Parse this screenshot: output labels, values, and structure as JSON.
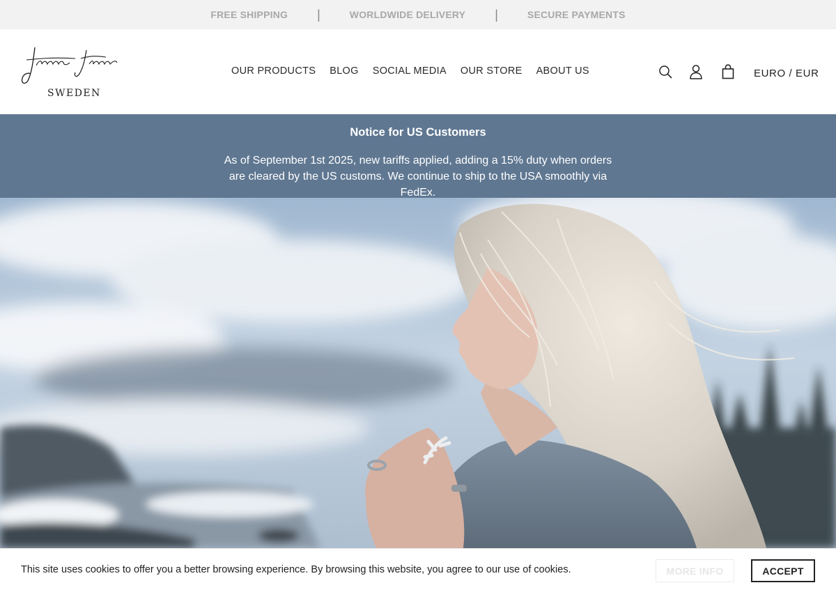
{
  "topbar": {
    "items": [
      "FREE SHIPPING",
      "WORLDWIDE DELIVERY",
      "SECURE PAYMENTS"
    ],
    "separator": "|"
  },
  "header": {
    "logo": {
      "signature": "Janna Sjöstam",
      "subtitle": "SWEDEN"
    },
    "nav": [
      "OUR PRODUCTS",
      "BLOG",
      "SOCIAL MEDIA",
      "OUR STORE",
      "ABOUT US"
    ],
    "icons": [
      "search-icon",
      "user-icon",
      "bag-icon"
    ],
    "currency": "EURO / EUR"
  },
  "notice": {
    "title": "Notice for US Customers",
    "body": "As of September 1st 2025, new tariffs applied, adding a 15% duty when orders are cleared by the US customs. We continue to ship to the USA smoothly via FedEx."
  },
  "cookie": {
    "text": "This site uses cookies to offer you a better browsing experience. By browsing this website, you agree to our use of cookies.",
    "more_label": "MORE INFO",
    "accept_label": "ACCEPT"
  },
  "colors": {
    "notice_bg": "#5f7791",
    "topbar_bg": "#f2f2f2",
    "topbar_text": "#a8a8a8"
  }
}
